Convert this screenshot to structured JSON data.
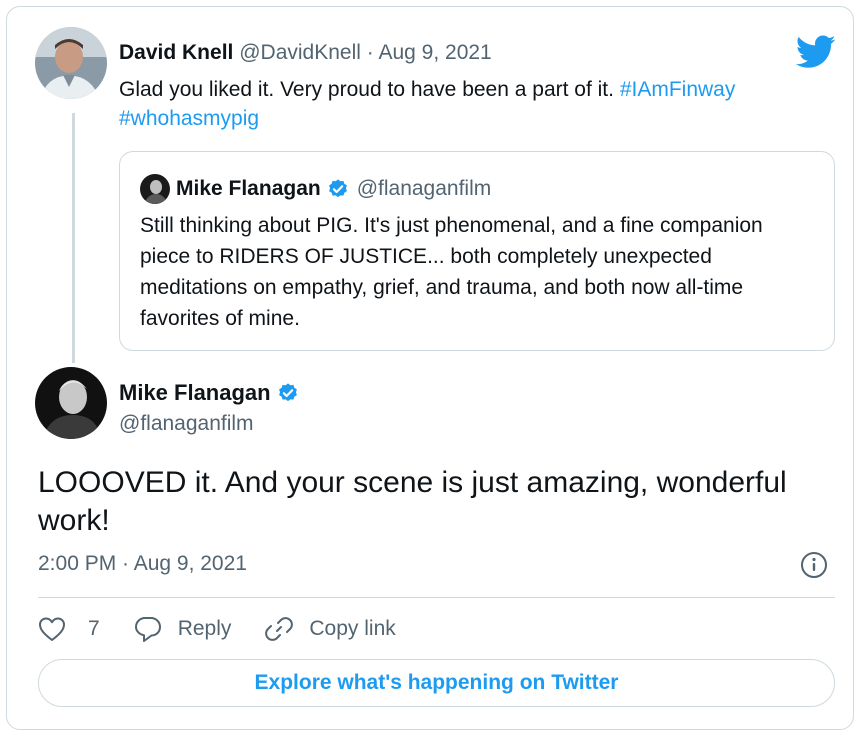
{
  "reply": {
    "author_name": "David Knell",
    "author_handle": "@DavidKnell",
    "separator": "·",
    "date": "Aug 9, 2021",
    "text": "Glad you liked it. Very proud to have been a part of it.",
    "hashtags": [
      "#IAmFinway",
      "#whohasmypig"
    ]
  },
  "quoted_tweet": {
    "author_name": "Mike Flanagan",
    "author_handle": "@flanaganfilm",
    "text": "Still thinking about PIG. It's just phenomenal, and a fine companion piece to RIDERS OF JUSTICE... both completely unexpected meditations on empathy, grief, and trauma, and both now all-time favorites of mine."
  },
  "main_tweet": {
    "author_name": "Mike Flanagan",
    "author_handle": "@flanaganfilm",
    "text": "LOOOVED it. And your scene is just amazing, wonderful work!",
    "timestamp": "2:00 PM · Aug 9, 2021"
  },
  "actions": {
    "like_count": "7",
    "reply_label": "Reply",
    "copy_link_label": "Copy link"
  },
  "explore_label": "Explore what's happening on Twitter",
  "icons": [
    "twitter-bird-icon",
    "verified-badge-icon",
    "info-icon",
    "heart-icon",
    "reply-bubble-icon",
    "link-icon"
  ],
  "colors": {
    "accent": "#1d9bf0",
    "text": "#0f1419",
    "muted": "#536471",
    "border": "#cfd9de"
  }
}
